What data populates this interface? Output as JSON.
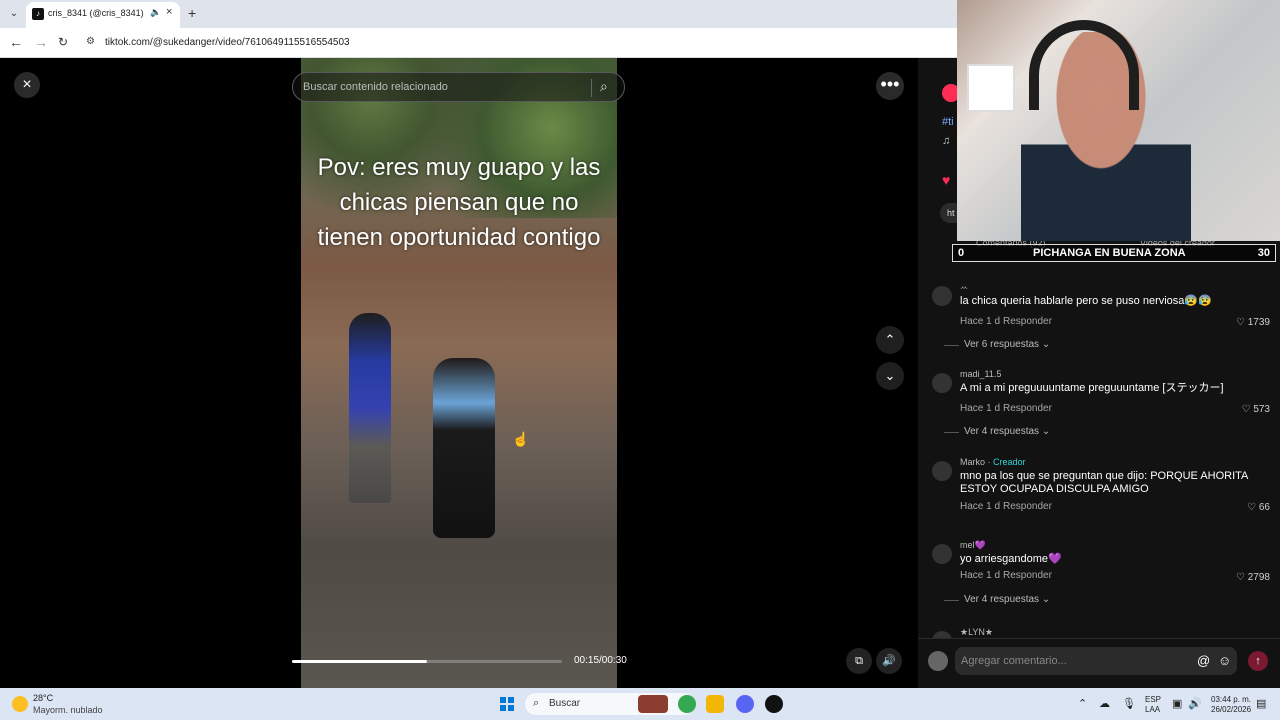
{
  "browser": {
    "tab_title": "cris_8341 (@cris_8341) | Tik",
    "url": "tiktok.com/@sukedanger/video/7610649115516554503"
  },
  "player": {
    "search_placeholder": "Buscar contenido relacionado",
    "caption": "Pov: eres muy guapo y las chicas piensan que no tienen oportunidad contigo",
    "time": "00:15/00:30",
    "progress": 0.5
  },
  "panel": {
    "partial_hashtag": "#ti",
    "link_partial": "ht",
    "tabs": {
      "comments": "Comentarios (92)",
      "creator_videos": "Videos del creador"
    },
    "scoreboard": {
      "left": "0",
      "title": "PICHANGA EN BUENA ZONA",
      "right": "30"
    },
    "comments": [
      {
        "user": "ꕀ",
        "text": "la chica queria hablarle pero se puso nerviosa😰😰",
        "time": "Hace 1 d",
        "reply": "Responder",
        "likes": "1739",
        "replies": "Ver 6 respuestas ⌄"
      },
      {
        "user": "madi_11.5",
        "text": "A mi a mi preguuuuntame preguuuntame [ステッカー]",
        "time": "Hace 1 d",
        "reply": "Responder",
        "likes": "573",
        "replies": "Ver 4 respuestas ⌄"
      },
      {
        "user": "Marko",
        "creator": "Creador",
        "text": "mno pa los que se preguntan que dijo: PORQUE AHORITA ESTOY OCUPADA DISCULPA AMIGO",
        "time": "Hace 1 d",
        "reply": "Responder",
        "likes": "66"
      },
      {
        "user": "mel💜",
        "text": "yo arriesgandome💜",
        "time": "Hace 1 d",
        "reply": "Responder",
        "likes": "2798",
        "replies": "Ver 4 respuestas ⌄"
      },
      {
        "user": "★LYN★",
        "text": ""
      }
    ],
    "comment_placeholder": "Agregar comentario..."
  },
  "taskbar": {
    "temperature": "28°C",
    "weather": "Mayorm. nublado",
    "search": "Buscar",
    "language": "ESP",
    "language_code": "LAA",
    "time": "03:44 p. m.",
    "date": "26/02/2026"
  },
  "icons": {
    "tab_menu": "chevron-down",
    "audio": "speaker",
    "close": "close",
    "back": "back-arrow",
    "forward": "forward-arrow",
    "reload": "reload",
    "search": "search",
    "more": "more-options",
    "up": "up-arrow",
    "down": "down-arrow",
    "pip": "picture-in-picture",
    "volume": "volume",
    "heart": "heart",
    "music": "music",
    "mention": "mention",
    "emoji": "emoji",
    "send": "send",
    "windows": "windows-start"
  },
  "colors": {
    "accent": "#ff2d55",
    "creator": "#2dd6d3",
    "browser": "#dfe3eb",
    "taskbar": "#dbe5f3"
  }
}
